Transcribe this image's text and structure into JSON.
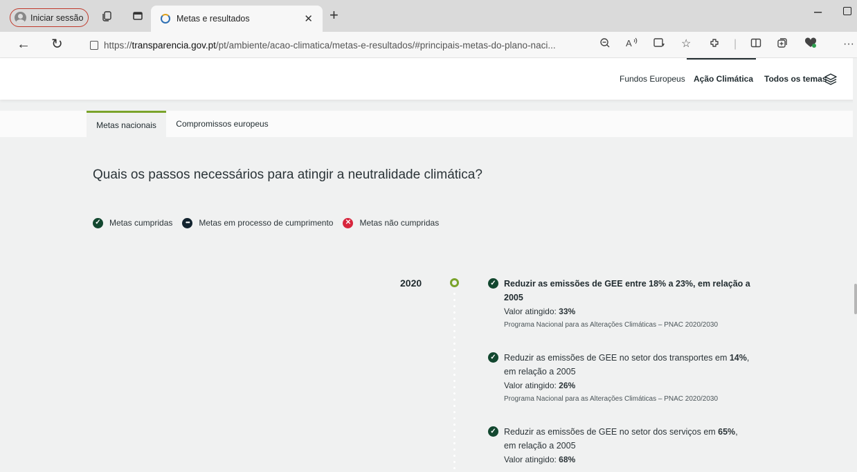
{
  "browser": {
    "profile_label": "Iniciar sessão",
    "tab_title": "Metas e resultados",
    "url_prefix": "https://",
    "url_domain": "transparencia.gov.pt",
    "url_path": "/pt/ambiente/acao-climatica/metas-e-resultados/#principais-metas-do-plano-naci..."
  },
  "site_nav": {
    "items": [
      "Fundos Europeus",
      "Ação Climática",
      "Todos os temas"
    ],
    "active": "Ação Climática"
  },
  "page_tabs": [
    "Metas nacionais",
    "Compromissos europeus"
  ],
  "question": "Quais os passos necessários para atingir a neutralidade climática?",
  "legend": {
    "met": "Metas cumpridas",
    "in_progress": "Metas em processo de cumprimento",
    "not_met": "Metas não cumpridas",
    "colors": {
      "met": "#12472f",
      "in_progress": "#12232e",
      "not_met": "#d7263d"
    }
  },
  "timeline": {
    "year": "2020",
    "accent": "#7aa32b",
    "goals": [
      {
        "text": "Reduzir as emissões de GEE entre 18% a 23%, em relação a 2005",
        "value_label": "Valor atingido: ",
        "value": "33%",
        "source": "Programa Nacional para as Alterações Climáticas – PNAC 2020/2030"
      },
      {
        "text_pre": "Reduzir as emissões de GEE no setor dos transportes em ",
        "text_bold": "14%",
        "text_post": ", em relação a 2005",
        "value_label": "Valor atingido: ",
        "value": "26%",
        "source": "Programa Nacional para as Alterações Climáticas – PNAC 2020/2030"
      },
      {
        "text_pre": "Reduzir as emissões de GEE no setor dos serviços em ",
        "text_bold": "65%",
        "text_post": ", em relação a 2005",
        "value_label": "Valor atingido: ",
        "value": "68%"
      }
    ]
  }
}
